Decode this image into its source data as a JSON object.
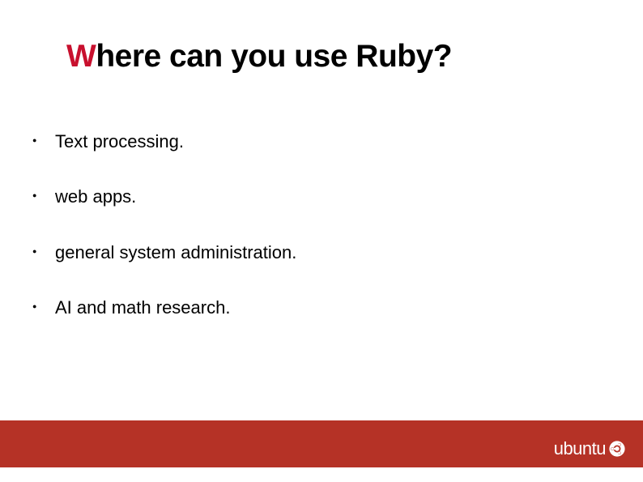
{
  "title": {
    "accent": "W",
    "rest": "here can you use Ruby?"
  },
  "bullets": [
    "Text processing.",
    "web apps.",
    "general system administration.",
    " AI and math research."
  ],
  "logo": {
    "text": "ubuntu"
  },
  "colors": {
    "accent": "#c8102e",
    "footer": "#b53226"
  }
}
